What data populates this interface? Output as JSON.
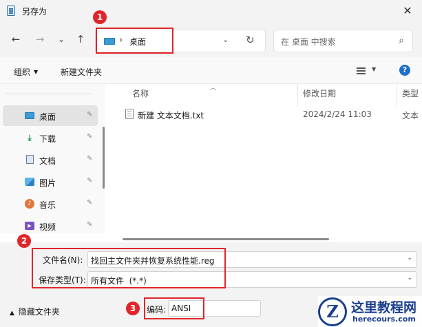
{
  "window": {
    "title": "另存为",
    "close_glyph": "✕"
  },
  "nav": {
    "back": "←",
    "forward": "→",
    "recent": "⌄",
    "up": "↑"
  },
  "address": {
    "separator": "›",
    "location": "桌面",
    "dropdown": "⌄",
    "refresh": "↻"
  },
  "search": {
    "placeholder": "在 桌面 中搜索",
    "icon": "⌕"
  },
  "toolbar": {
    "organize": "组织",
    "new_folder": "新建文件夹",
    "help": "?"
  },
  "sidebar": {
    "items": [
      {
        "label": "桌面",
        "icon": "desktop-icon",
        "active": true
      },
      {
        "label": "下载",
        "icon": "download-icon"
      },
      {
        "label": "文档",
        "icon": "document-icon"
      },
      {
        "label": "图片",
        "icon": "picture-icon"
      },
      {
        "label": "音乐",
        "icon": "music-icon"
      },
      {
        "label": "视频",
        "icon": "video-icon"
      }
    ],
    "pin_glyph": "📌"
  },
  "columns": {
    "name": "名称",
    "modified": "修改日期",
    "type": "类型"
  },
  "files": [
    {
      "name": "新建 文本文档.txt",
      "modified": "2024/2/24 11:03",
      "type": "文本"
    }
  ],
  "form": {
    "filename_label": "文件名(N):",
    "filename_value": "找回主文件夹并恢复系统性能.reg",
    "filetype_label": "保存类型(T):",
    "filetype_value": "所有文件  (*.*)"
  },
  "footer": {
    "hide_folders": "隐藏文件夹",
    "encoding_label": "编码:",
    "encoding_value": "ANSI"
  },
  "annotations": {
    "badge1": "1",
    "badge2": "2",
    "badge3": "3",
    "color": "#e0262a"
  },
  "watermark": {
    "logo_letter": "Z",
    "site_name": "这里教程网",
    "site_url": "herecours.com"
  }
}
